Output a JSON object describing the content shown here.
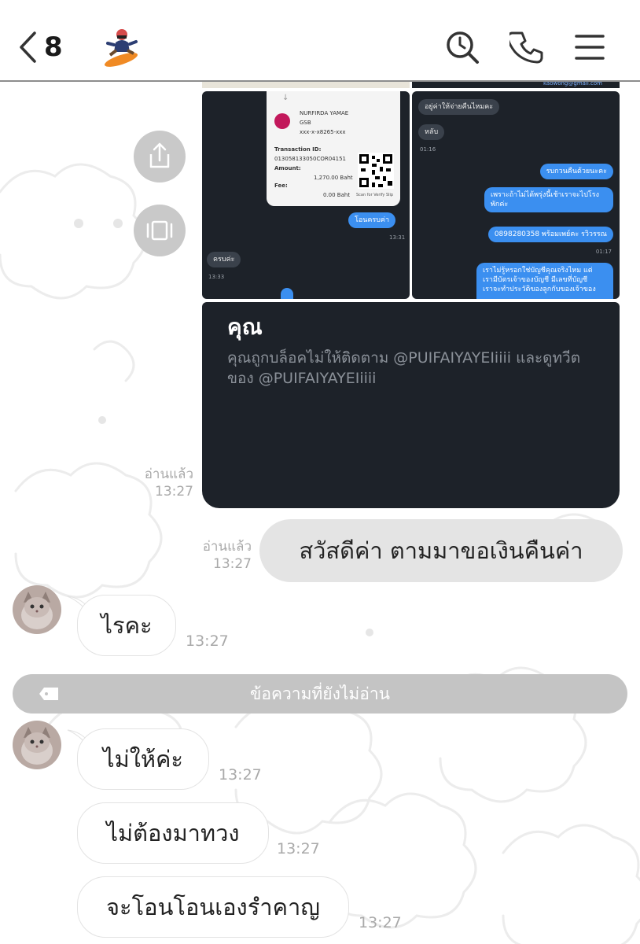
{
  "header": {
    "back_count": "8",
    "colors": {
      "divider": "#8d8d8d",
      "icon": "#333333"
    },
    "icons": [
      "back-chevron-icon",
      "snowboarder-emoji-icon",
      "search-history-icon",
      "phone-icon",
      "menu-icon"
    ]
  },
  "collage": {
    "receipt": {
      "name": "NURFIRDA YAMAE",
      "bank": "GSB",
      "account": "xxx-x-x8265-xxx",
      "transaction_label": "Transaction ID:",
      "transaction_id": "013058133050COR04151",
      "amount_label": "Amount:",
      "amount": "1,270.00 Baht",
      "fee_label": "Fee:",
      "fee": "0.00 Baht",
      "scan_label": "Scan for Verify Slip",
      "logo_text": "ออมสิน"
    },
    "left_messages": [
      {
        "text": "โอนครบค่า",
        "time": "13:31",
        "dir": "out"
      },
      {
        "text": "ครบค่ะ",
        "time": "13:33",
        "dir": "in"
      }
    ],
    "right_email": "kaowong@gmail.com",
    "right_messages": [
      {
        "text": "อยู่ค่าให้จ่ายคืนไหมคะ",
        "dir": "in"
      },
      {
        "text": "หลับ",
        "time": "01:16",
        "dir": "in"
      },
      {
        "text": "รบกวนคืนด้วยนะคะ",
        "dir": "out"
      },
      {
        "text": "เพราะถ้าไม่ได้พรุ่งนี้เช้าเราจะไปโรง",
        "text2": "พักค่ะ",
        "dir": "out"
      },
      {
        "text": "0898280358 พร้อมเพย์คะ รวิวรรณ",
        "time": "01:17",
        "dir": "out"
      },
      {
        "text": "เราไม่รู้หรอกใช่บัญชีคุณจริงไหม แต่",
        "text2": "เรามีบัตรเจ้าของบัญชี มีเลขที่บัญชี",
        "text3": "เราจะทำประวัติของลูกกับของเจ้าของ",
        "dir": "out"
      }
    ],
    "blocked_title": "คุณ",
    "blocked_text": "คุณถูกบล็อคไม่ให้ติดตาม @PUIFAIYAYEIiiii และดูทวีต ของ @PUIFAIYAYEIiiii"
  },
  "chat": {
    "read_label": "อ่านแล้ว",
    "messages": [
      {
        "dir": "out",
        "text": "สวัสดีค่า ตามมาขอเงินคืนค่า",
        "time": "13:27"
      },
      {
        "dir": "in",
        "text": "ไรคะ",
        "time": "13:27"
      },
      {
        "dir": "in",
        "text": "ไม่ให้ค่ะ",
        "time": "13:27"
      },
      {
        "dir": "in",
        "text": "ไม่ต้องมาทวง",
        "time": "13:27"
      },
      {
        "dir": "in",
        "text": "จะโอนโอนเองรำคาญ",
        "time": "13:27"
      }
    ],
    "image_read_time": "13:27",
    "unread_divider": "ข้อความที่ยังไม่อ่าน",
    "colors": {
      "outgoing_bubble": "#e4e4e4",
      "incoming_bubble": "#ffffff",
      "unread_bar": "#c4c4c4",
      "meta_text": "#a9a9a9"
    }
  }
}
